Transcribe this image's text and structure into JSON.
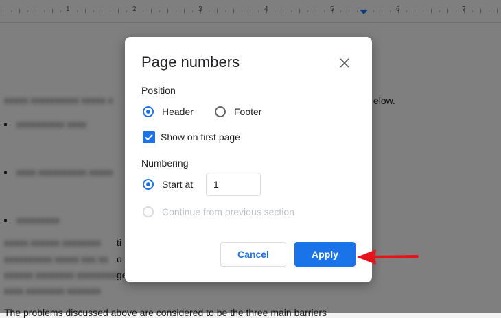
{
  "ruler": {
    "numbers": [
      "1",
      "2",
      "3",
      "4",
      "5",
      "6",
      "7"
    ]
  },
  "document": {
    "lines": {
      "line1_tail": "elow.",
      "para_tail1": "ti",
      "para_tail2": "o",
      "para_tail3": "ge",
      "bottom_text": "The problems discussed above are considered to be the three main barriers"
    }
  },
  "dialog": {
    "title": "Page numbers",
    "close_icon": "close-icon",
    "position": {
      "label": "Position",
      "header_label": "Header",
      "footer_label": "Footer",
      "selected": "Header",
      "show_first_page_label": "Show on first page",
      "show_first_page_checked": true
    },
    "numbering": {
      "label": "Numbering",
      "start_at_label": "Start at",
      "start_at_value": "1",
      "continue_label": "Continue from previous section"
    },
    "buttons": {
      "cancel": "Cancel",
      "apply": "Apply"
    }
  },
  "colors": {
    "accent": "#1a73e8",
    "annotation_arrow": "#e8121c"
  }
}
